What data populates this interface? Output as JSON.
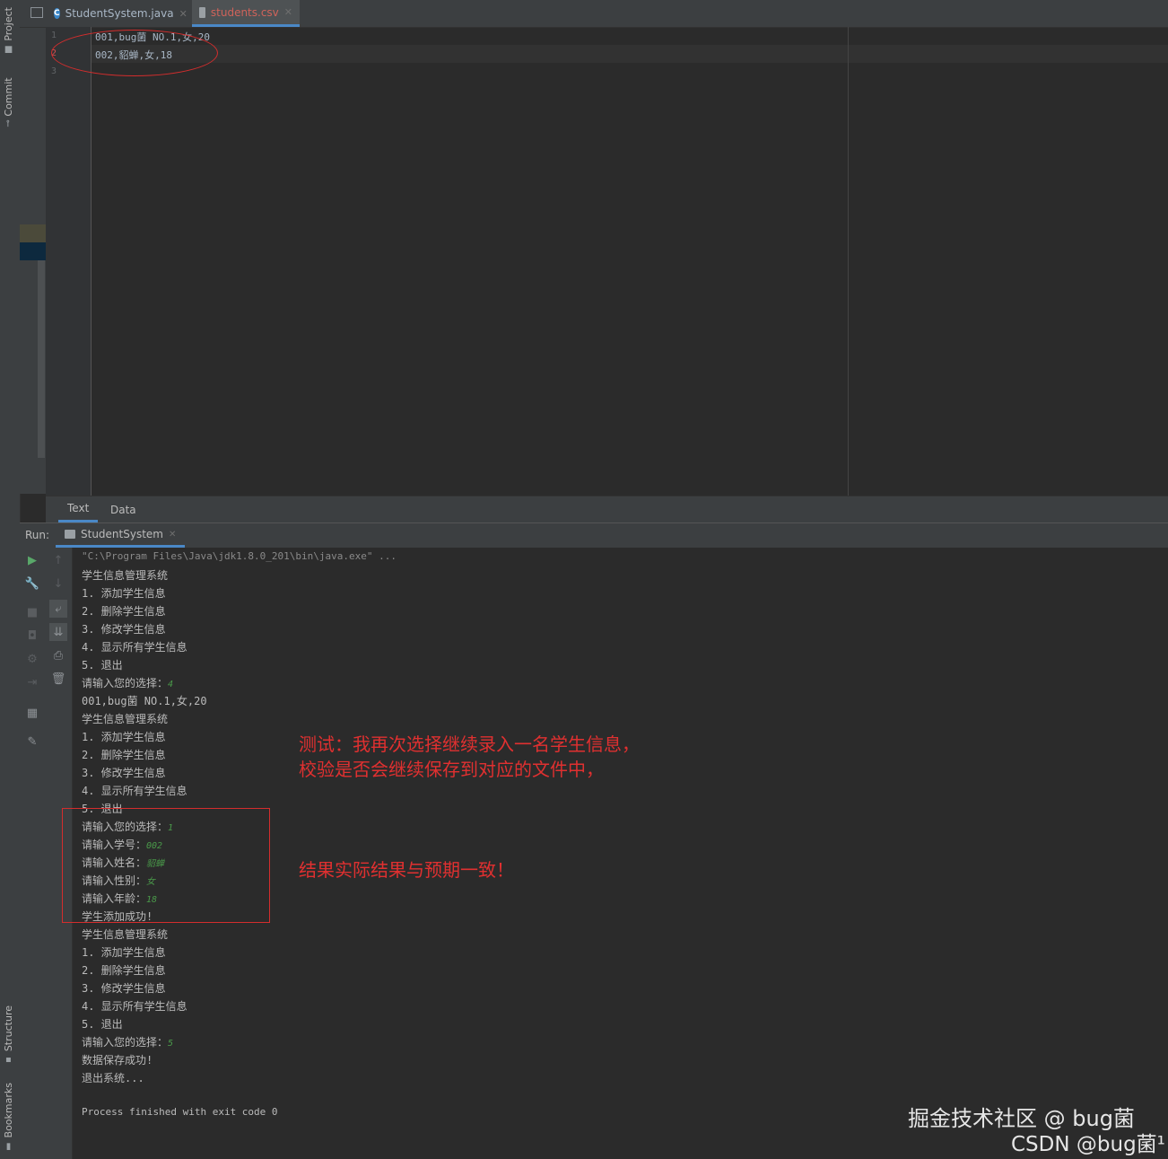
{
  "left_stripe": {
    "project_label": "Project",
    "commit_label": "Commit",
    "structure_label": "Structure",
    "bookmarks_label": "Bookmarks"
  },
  "tabs": [
    {
      "label": "StudentSystem.java",
      "active": false
    },
    {
      "label": "students.csv",
      "active": true
    }
  ],
  "editor": {
    "line_numbers": [
      "1",
      "2",
      "3"
    ],
    "lines": [
      "001,bug菌 NO.1,女,20",
      "002,貂蝉,女,18",
      ""
    ]
  },
  "editor_bottom_tabs": {
    "text": "Text",
    "data": "Data"
  },
  "run": {
    "label": "Run:",
    "tab_label": "StudentSystem"
  },
  "console": {
    "command": "\"C:\\Program Files\\Java\\jdk1.8.0_201\\bin\\java.exe\" ...",
    "menu_title": "学生信息管理系统",
    "menu_items": [
      "1. 添加学生信息",
      "2. 删除学生信息",
      "3. 修改学生信息",
      "4. 显示所有学生信息",
      "5. 退出"
    ],
    "prompt_choice": "请输入您的选择：",
    "choice_1": "4",
    "record_line": "001,bug菌 NO.1,女,20",
    "choice_2": "1",
    "prompt_id": "请输入学号：",
    "input_id": "002",
    "prompt_name": "请输入姓名：",
    "input_name": "貂蝉",
    "prompt_gender": "请输入性别：",
    "input_gender": "女",
    "prompt_age": "请输入年龄：",
    "input_age": "18",
    "add_success": "学生添加成功!",
    "choice_3": "5",
    "save_success": "数据保存成功!",
    "exit_msg": "退出系统...",
    "finished": "Process finished with exit code 0"
  },
  "annotations": {
    "note_line1": "测试：我再次选择继续录入一名学生信息，",
    "note_line2": "校验是否会继续保存到对应的文件中，",
    "result": "结果实际结果与预期一致！"
  },
  "watermark": {
    "line1": "掘金技术社区 @ bug菌",
    "line2": "CSDN @bug菌¹"
  },
  "colors": {
    "annotation_red": "#e03030",
    "active_tab_text": "#d0635a",
    "accent_blue": "#4a88c7",
    "user_input_green": "#4a9a4a"
  }
}
